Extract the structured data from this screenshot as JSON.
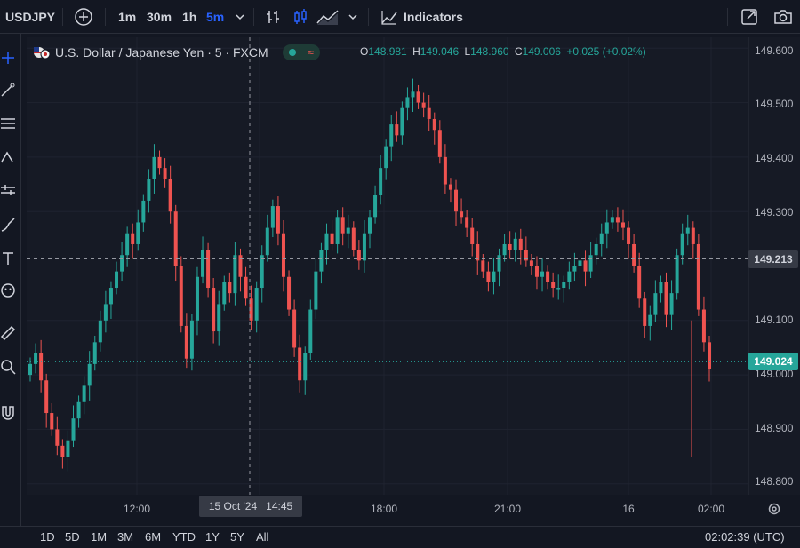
{
  "toolbar": {
    "symbol": "USDJPY",
    "intervals": [
      "1m",
      "30m",
      "1h",
      "5m"
    ],
    "active_interval": "5m",
    "indicators_label": "Indicators",
    "icons": [
      "plus-circle-icon",
      "bar-style-icon",
      "candle-style-icon",
      "area-style-icon",
      "chevron-down-icon",
      "indicators-icon",
      "fullscreen-icon",
      "camera-icon"
    ]
  },
  "legend": {
    "title": "U.S. Dollar / Japanese Yen · 5 · FXCM",
    "open_label": "O",
    "open": "148.981",
    "high_label": "H",
    "high": "149.046",
    "low_label": "L",
    "low": "148.960",
    "close_label": "C",
    "close": "149.006",
    "change": "+0.025 (+0.02%)"
  },
  "price_axis": {
    "labels": [
      "149.600",
      "149.500",
      "149.400",
      "149.300",
      "149.100",
      "149.000",
      "148.900",
      "148.800"
    ],
    "crosshair_price": "149.213",
    "last_price": "149.024"
  },
  "time_axis": {
    "labels": [
      "12:00",
      "18:00",
      "21:00",
      "16",
      "02:00"
    ],
    "crosshair_date": "15 Oct '24",
    "crosshair_time": "14:45"
  },
  "bottom": {
    "ranges": [
      "1D",
      "5D",
      "1M",
      "3M",
      "6M",
      "YTD",
      "1Y",
      "5Y",
      "All"
    ],
    "clock": "02:02:39 (UTC)"
  },
  "colors": {
    "up": "#26a69a",
    "down": "#ef5350",
    "accent": "#2962ff",
    "bg": "#131722"
  },
  "chart_data": {
    "type": "candlestick",
    "symbol": "USDJPY",
    "timeframe": "5",
    "ylim": [
      148.78,
      149.62
    ],
    "x_ticks": [
      "12:00",
      "18:00",
      "21:00",
      "16",
      "02:00"
    ],
    "series": [
      {
        "values": [
          149.02,
          149.04,
          148.99,
          148.93,
          148.9,
          148.87,
          148.85,
          148.88,
          148.92,
          148.95,
          148.98,
          149.02,
          149.06,
          149.1,
          149.13,
          149.16,
          149.19,
          149.22,
          149.26,
          149.24,
          149.28,
          149.32,
          149.36,
          149.4,
          149.38,
          149.36,
          149.3,
          149.2,
          149.09,
          149.03,
          149.1,
          149.18,
          149.23,
          149.16,
          149.08,
          149.13,
          149.17,
          149.15,
          149.22,
          149.18,
          149.14,
          149.1,
          149.16,
          149.22,
          149.27,
          149.31,
          149.26,
          149.18,
          149.12,
          149.05,
          148.99,
          149.04,
          149.12,
          149.19,
          149.23,
          149.26,
          149.24,
          149.29,
          149.26,
          149.27,
          149.23,
          149.21,
          149.26,
          149.29,
          149.33,
          149.38,
          149.42,
          149.46,
          149.44,
          149.49,
          149.51,
          149.52,
          149.5,
          149.49,
          149.47,
          149.45,
          149.4,
          149.35,
          149.34,
          149.3,
          149.29,
          149.27,
          149.24,
          149.21,
          149.19,
          149.17,
          149.19,
          149.22,
          149.24,
          149.23,
          149.25,
          149.23,
          149.21,
          149.2,
          149.18,
          149.19,
          149.17,
          149.16,
          149.16,
          149.17,
          149.19,
          149.2,
          149.21,
          149.19,
          149.22,
          149.24,
          149.26,
          149.28,
          149.29,
          149.28,
          149.27,
          149.24,
          149.2,
          149.14,
          149.09,
          149.11,
          149.15,
          149.17,
          149.11,
          149.15,
          149.22,
          149.26,
          149.27,
          149.24,
          149.12,
          149.06,
          149.01
        ]
      }
    ]
  }
}
